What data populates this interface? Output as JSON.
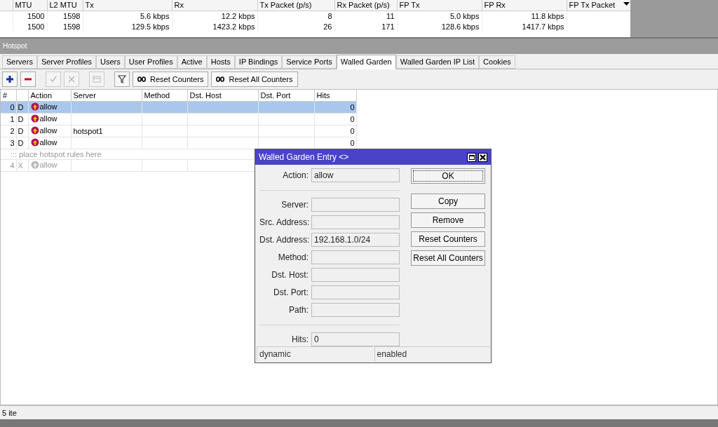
{
  "interfaces_table": {
    "columns": [
      "MTU",
      "L2 MTU",
      "Tx",
      "Rx",
      "Tx Packet (p/s)",
      "Rx Packet (p/s)",
      "FP Tx",
      "FP Rx",
      "FP Tx Packet"
    ],
    "rows": [
      [
        "1500",
        "1598",
        "5.6 kbps",
        "12.2 kbps",
        "8",
        "11",
        "5.0 kbps",
        "11.8 kbps",
        ""
      ],
      [
        "1500",
        "1598",
        "129.5 kbps",
        "1423.2 kbps",
        "26",
        "171",
        "128.6 kbps",
        "1417.7 kbps",
        ""
      ]
    ]
  },
  "hotspot": {
    "title": "Hotspot",
    "tabs": [
      {
        "label": "Servers",
        "selected": false
      },
      {
        "label": "Server Profiles",
        "selected": false
      },
      {
        "label": "Users",
        "selected": false
      },
      {
        "label": "User Profiles",
        "selected": false
      },
      {
        "label": "Active",
        "selected": false
      },
      {
        "label": "Hosts",
        "selected": false
      },
      {
        "label": "IP Bindings",
        "selected": false
      },
      {
        "label": "Service Ports",
        "selected": false
      },
      {
        "label": "Walled Garden",
        "selected": true
      },
      {
        "label": "Walled Garden IP List",
        "selected": false
      },
      {
        "label": "Cookies",
        "selected": false
      }
    ],
    "toolbar": [
      {
        "kind": "add",
        "disabled": false
      },
      {
        "kind": "remove",
        "disabled": false
      },
      {
        "kind": "enable",
        "disabled": true
      },
      {
        "kind": "disable",
        "disabled": true
      },
      {
        "kind": "comment",
        "disabled": true
      },
      {
        "kind": "filter",
        "disabled": false
      },
      {
        "kind": "reset",
        "label": "Reset Counters",
        "disabled": false
      },
      {
        "kind": "reset",
        "label": "Reset All Counters",
        "disabled": false
      }
    ],
    "table": {
      "columns": [
        "#",
        "",
        "Action",
        "Server",
        "Method",
        "Dst. Host",
        "Dst. Port",
        "Hits"
      ],
      "rows": [
        {
          "kind": "rule",
          "number": "0",
          "flag": "D",
          "action": "allow",
          "server": "",
          "hits": "0",
          "selected": true,
          "disabled": false
        },
        {
          "kind": "rule",
          "number": "1",
          "flag": "D",
          "action": "allow",
          "server": "",
          "hits": "0",
          "selected": false,
          "disabled": false
        },
        {
          "kind": "rule",
          "number": "2",
          "flag": "D",
          "action": "allow",
          "server": "hotspot1",
          "hits": "0",
          "selected": false,
          "disabled": false
        },
        {
          "kind": "rule",
          "number": "3",
          "flag": "D",
          "action": "allow",
          "server": "",
          "hits": "0",
          "selected": false,
          "disabled": false
        },
        {
          "kind": "comment",
          "text": "::: place hotspot rules here"
        },
        {
          "kind": "rule",
          "number": "4",
          "flag": "X",
          "action": "allow",
          "server": "",
          "hits": "",
          "selected": false,
          "disabled": true
        }
      ]
    },
    "status": "5 ite"
  },
  "dialog": {
    "title": "Walled Garden Entry <>",
    "fields": [
      {
        "kind": "field",
        "label": "Action:",
        "value": "allow"
      },
      {
        "kind": "separator"
      },
      {
        "kind": "field",
        "label": "Server:"
      },
      {
        "kind": "field",
        "label": "Src. Address:"
      },
      {
        "kind": "field",
        "label": "Dst. Address:",
        "value": "192.168.1.0/24"
      },
      {
        "kind": "field",
        "label": "Method:"
      },
      {
        "kind": "field",
        "label": "Dst. Host:"
      },
      {
        "kind": "field",
        "label": "Dst. Port:"
      },
      {
        "kind": "field",
        "label": "Path:"
      },
      {
        "kind": "separator"
      },
      {
        "kind": "field",
        "label": "Hits:",
        "value": "0"
      }
    ],
    "buttons": [
      {
        "label": "OK",
        "default": true
      },
      {
        "label": "Copy",
        "default": false
      },
      {
        "label": "Remove",
        "default": false
      },
      {
        "label": "Reset Counters",
        "default": false
      },
      {
        "label": "Reset All Counters",
        "default": false
      }
    ],
    "status": [
      "dynamic",
      "enabled"
    ]
  }
}
